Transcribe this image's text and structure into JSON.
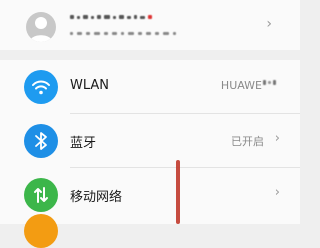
{
  "account": {
    "name_obscured": true,
    "info_obscured": true
  },
  "settings": {
    "items": [
      {
        "label": "WLAN",
        "value": "HUAWE",
        "value_obscured_suffix": true,
        "icon": "wifi-icon",
        "icon_color": "#1e9bf0"
      },
      {
        "label": "蓝牙",
        "value": "已开启",
        "icon": "bluetooth-icon",
        "icon_color": "#1e8fe6",
        "chevron": "›"
      },
      {
        "label": "移动网络",
        "value": "",
        "icon": "mobile-network-icon",
        "icon_color": "#3cb64a",
        "chevron": "›"
      }
    ]
  },
  "account_chevron": "›",
  "colors": {
    "background": "#efefef",
    "card": "#fafafa",
    "partial_icon": "#f39c12",
    "annotation": "#c0392b"
  }
}
